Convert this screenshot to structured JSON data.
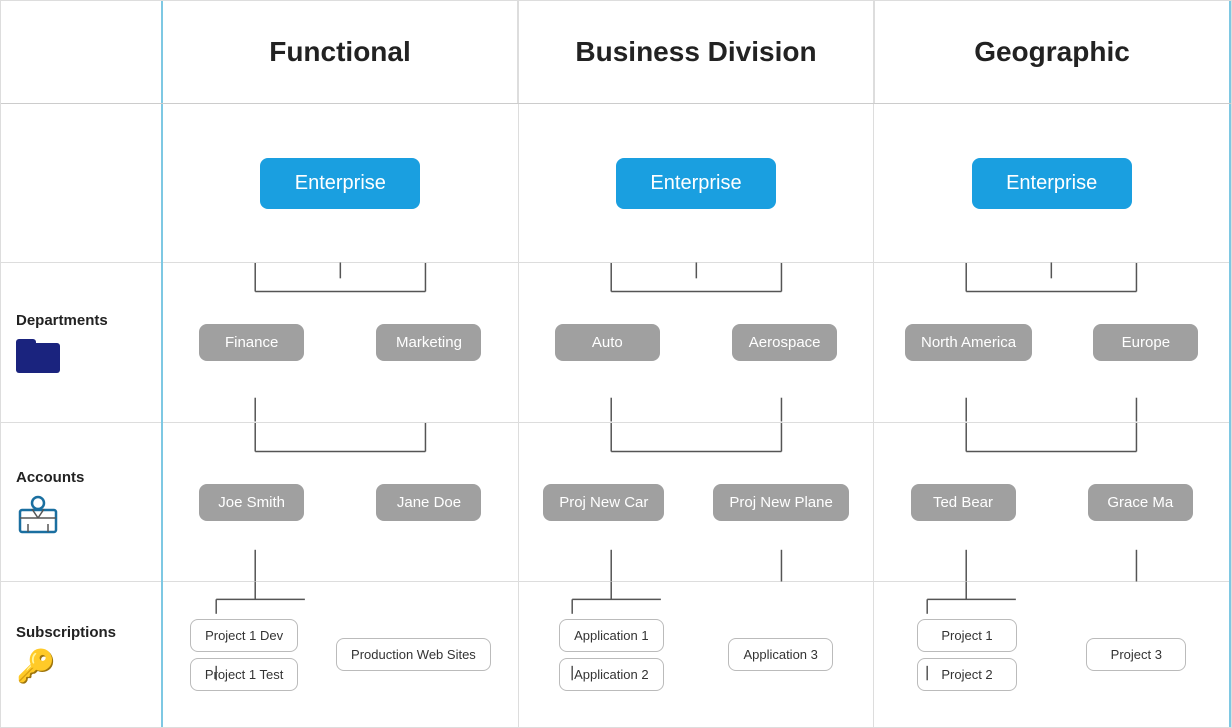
{
  "header": {
    "sections": [
      {
        "id": "functional",
        "title": "Functional"
      },
      {
        "id": "business-division",
        "title": "Business Division"
      },
      {
        "id": "geographic",
        "title": "Geographic"
      }
    ]
  },
  "labels": [
    {
      "id": "enterprise",
      "text": ""
    },
    {
      "id": "departments",
      "text": "Departments",
      "icon": "folder"
    },
    {
      "id": "accounts",
      "text": "Accounts",
      "icon": "accounts"
    },
    {
      "id": "subscriptions",
      "text": "Subscriptions",
      "icon": "key"
    }
  ],
  "functional": {
    "enterprise": "Enterprise",
    "departments": [
      "Finance",
      "Marketing"
    ],
    "accounts": [
      "Joe Smith",
      "Jane Doe"
    ],
    "subscriptions_left": [
      "Project 1 Dev",
      "Project 1 Test"
    ],
    "subscriptions_right": [
      "Production Web Sites"
    ]
  },
  "business_division": {
    "enterprise": "Enterprise",
    "departments": [
      "Auto",
      "Aerospace"
    ],
    "accounts": [
      "Proj New Car",
      "Proj New Plane"
    ],
    "subscriptions_left": [
      "Application 1",
      "Application 2"
    ],
    "subscriptions_right": [
      "Application 3"
    ]
  },
  "geographic": {
    "enterprise": "Enterprise",
    "departments": [
      "North America",
      "Europe"
    ],
    "accounts": [
      "Ted Bear",
      "Grace Ma"
    ],
    "subscriptions_left": [
      "Project 1",
      "Project 2"
    ],
    "subscriptions_right": [
      "Project 3"
    ]
  }
}
